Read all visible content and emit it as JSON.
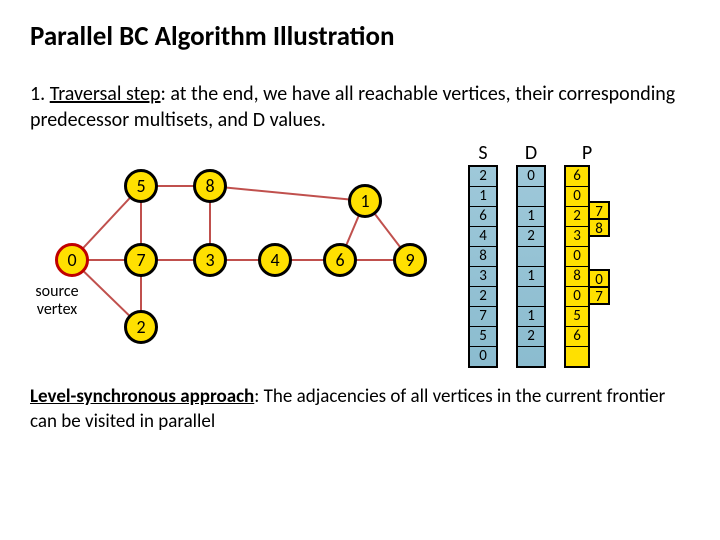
{
  "title": "Parallel BC Algorithm Illustration",
  "step": {
    "num": "1.",
    "label": "Traversal step",
    "rest": ": at the end, we have all reachable vertices, their corresponding predecessor multisets, and D values."
  },
  "src_label": "source\nvertex",
  "nodes": {
    "n0": "0",
    "n5": "5",
    "n7": "7",
    "n2": "2",
    "n8": "8",
    "n3": "3",
    "n4": "4",
    "n1": "1",
    "n6": "6",
    "n9": "9"
  },
  "hdr": {
    "S": "S",
    "D": "D",
    "P": "P"
  },
  "S": [
    "2",
    "1",
    "6",
    "4",
    "8",
    "3",
    "2",
    "7",
    "5",
    "0"
  ],
  "D": [
    "0",
    "",
    "1",
    "2",
    "",
    "1",
    "",
    "1",
    "2",
    ""
  ],
  "P": [
    "6",
    "0",
    "2",
    "3",
    "0",
    "8",
    "0",
    "5",
    "6",
    ""
  ],
  "Pside": [
    "",
    "",
    "7",
    "8",
    "",
    "",
    "0",
    "7",
    "",
    ""
  ],
  "footer": {
    "label": "Level-synchronous approach",
    "rest": ": The adjacencies of all vertices in the current frontier can be visited in parallel"
  }
}
